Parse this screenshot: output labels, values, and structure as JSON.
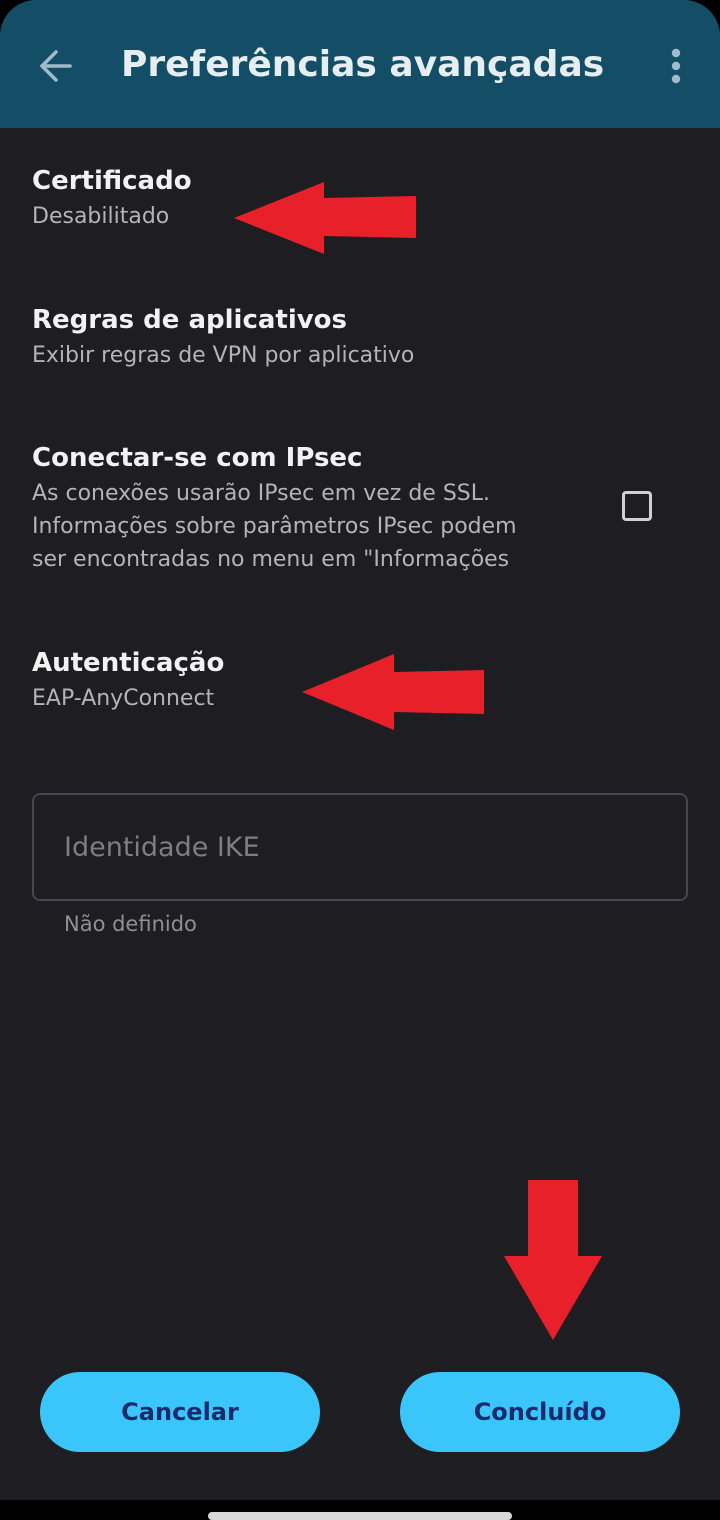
{
  "appbar": {
    "title": "Preferências avançadas",
    "back_icon": "arrow-left-icon",
    "menu_icon": "more-vert-icon"
  },
  "preferences": [
    {
      "title": "Certificado",
      "summary": "Desabilitado"
    },
    {
      "title": "Regras de aplicativos",
      "summary": "Exibir regras de VPN por aplicativo"
    },
    {
      "title": "Conectar-se com IPsec",
      "summary_lines": [
        "As conexões usarão IPsec em vez de SSL.",
        "Informações sobre parâmetros IPsec podem",
        "ser encontradas no menu em \"Informações"
      ],
      "checked": false
    },
    {
      "title": "Autenticação",
      "summary": "EAP-AnyConnect"
    }
  ],
  "ike_identity": {
    "placeholder": "Identidade IKE",
    "value": "",
    "helper": "Não definido"
  },
  "buttons": {
    "cancel": "Cancelar",
    "done": "Concluído"
  },
  "colors": {
    "appbar": "#144e66",
    "background": "#1e1e22",
    "button": "#3ac6fb",
    "button_text": "#1a2a6c",
    "annotation_arrow": "#e8202a"
  }
}
